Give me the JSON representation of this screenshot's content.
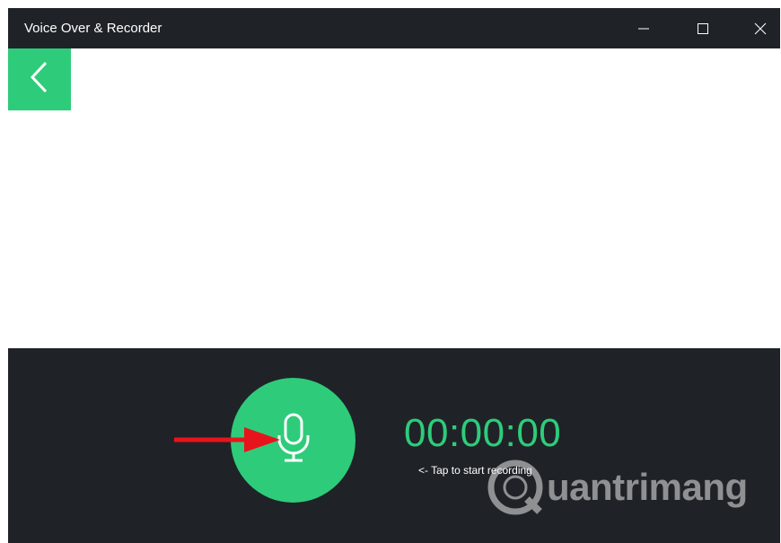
{
  "window": {
    "title": "Voice Over & Recorder"
  },
  "titlebar": {
    "minimize_icon": "minimize-icon",
    "maximize_icon": "maximize-icon",
    "close_icon": "close-icon"
  },
  "toolbar": {
    "back_icon": "chevron-left-icon"
  },
  "recorder": {
    "mic_icon": "microphone-icon",
    "timer": "00:00:00",
    "hint": "<- Tap to start recording"
  },
  "watermark": {
    "text": "uantrimang"
  },
  "colors": {
    "accent": "#2ecc7a",
    "background": "#1f2328",
    "arrow": "#e8141c"
  }
}
